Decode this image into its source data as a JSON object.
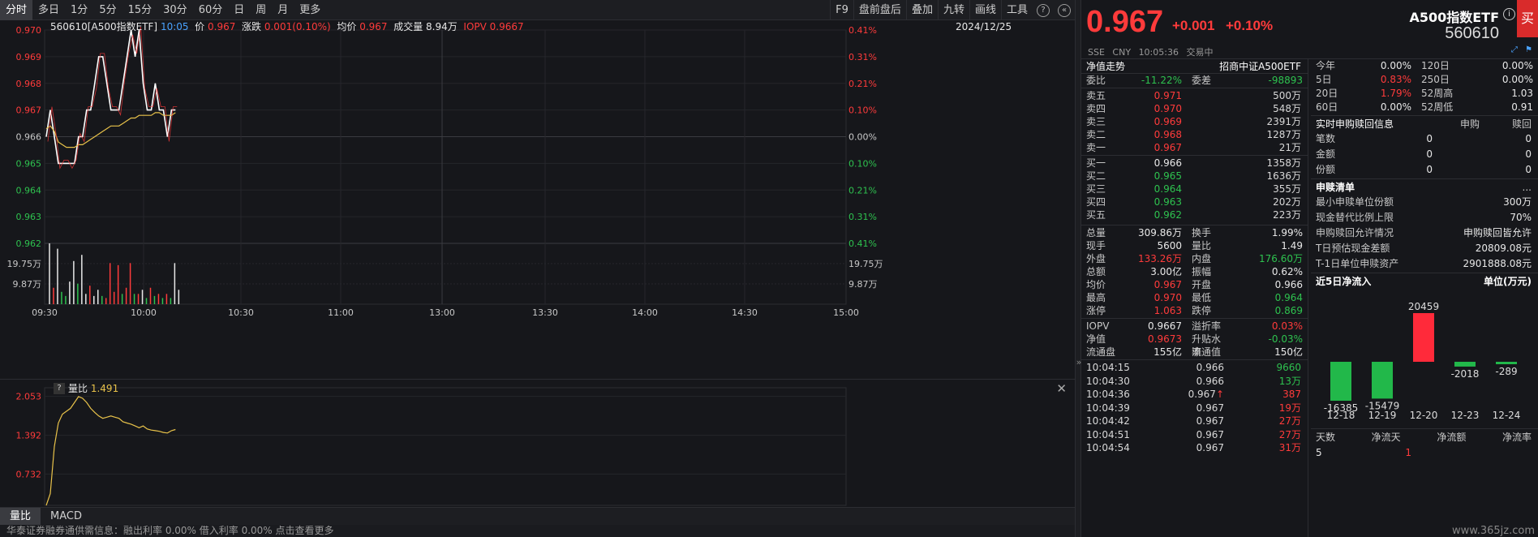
{
  "period_tabs": [
    "分时",
    "多日",
    "1分",
    "5分",
    "15分",
    "30分",
    "60分",
    "日",
    "周",
    "月",
    "更多"
  ],
  "toolbar_right": [
    "F9",
    "盘前盘后",
    "叠加",
    "九转",
    "画线",
    "工具"
  ],
  "toolbar_icons": {
    "help": "?",
    "collapse": "«"
  },
  "chart_header": {
    "symbol": "560610[A500指数ETF]",
    "time": "10:05",
    "price_label": "价",
    "price": "0.967",
    "change_label": "涨跌",
    "change": "0.001(0.10%)",
    "avg_label": "均价",
    "avg": "0.967",
    "vol_label": "成交量",
    "vol": "8.94万",
    "iopv_label": "IOPV",
    "iopv": "0.9667",
    "date": "2024/12/25"
  },
  "sub_header": {
    "q": "?",
    "label": "量比",
    "value": "1.491"
  },
  "bottom_tabs": [
    "量比",
    "MACD"
  ],
  "ticker_text": "华泰证券融券通供需信息：融出利率 0.00%  借入利率 0.00%  点击查看更多",
  "colors": {
    "up": "#ff3b3b",
    "down": "#2ec24f",
    "price_line": "#ffffff",
    "avg_line": "#e8c24a",
    "bg": "#16171b"
  },
  "chart_data": {
    "type": "line",
    "x_ticks": [
      "09:30",
      "10:00",
      "10:30",
      "11:00",
      "13:00",
      "13:30",
      "14:00",
      "14:30",
      "15:00"
    ],
    "y_ticks_price": [
      "0.970",
      "0.969",
      "0.968",
      "0.967",
      "0.966",
      "0.965",
      "0.964",
      "0.963",
      "0.962"
    ],
    "y_ticks_pct": [
      "0.41%",
      "0.31%",
      "0.21%",
      "0.10%",
      "0.00%",
      "0.10%",
      "0.21%",
      "0.31%",
      "0.41%"
    ],
    "ylim": [
      0.962,
      0.97
    ],
    "prev_close": 0.966,
    "volume_ticks": [
      "19.75万",
      "9.87万"
    ],
    "volume_max": 29.6,
    "ratio_ticks": [
      "2.053",
      "1.392",
      "0.732"
    ],
    "ratio_ylim": [
      0.2,
      2.2
    ],
    "series": [
      {
        "values": [
          0.966,
          0.967,
          0.966,
          0.965,
          0.965,
          0.965,
          0.965,
          0.965,
          0.966,
          0.966,
          0.967,
          0.967,
          0.968,
          0.969,
          0.969,
          0.968,
          0.967,
          0.967,
          0.967,
          0.968,
          0.969,
          0.97,
          0.969,
          0.97,
          0.968,
          0.967,
          0.967,
          0.968,
          0.967,
          0.967,
          0.966,
          0.967,
          0.967
        ]
      },
      {
        "values": [
          0.9663,
          0.9664,
          0.9662,
          0.9658,
          0.9657,
          0.9656,
          0.9656,
          0.9656,
          0.9657,
          0.9657,
          0.9658,
          0.9659,
          0.966,
          0.9661,
          0.9662,
          0.9663,
          0.9664,
          0.9664,
          0.9664,
          0.9665,
          0.9666,
          0.9667,
          0.9667,
          0.9668,
          0.9668,
          0.9668,
          0.9668,
          0.9669,
          0.9669,
          0.9668,
          0.9668,
          0.9668,
          0.9669
        ]
      }
    ],
    "volumes": [
      {
        "v": 29.6,
        "c": "white"
      },
      {
        "v": 8,
        "c": "red"
      },
      {
        "v": 27,
        "c": "white"
      },
      {
        "v": 6,
        "c": "green"
      },
      {
        "v": 4,
        "c": "green"
      },
      {
        "v": 11,
        "c": "white"
      },
      {
        "v": 21,
        "c": "white"
      },
      {
        "v": 10,
        "c": "green"
      },
      {
        "v": 24,
        "c": "white"
      },
      {
        "v": 5,
        "c": "white"
      },
      {
        "v": 9,
        "c": "red"
      },
      {
        "v": 4,
        "c": "white"
      },
      {
        "v": 7,
        "c": "white"
      },
      {
        "v": 4,
        "c": "green"
      },
      {
        "v": 3,
        "c": "red"
      },
      {
        "v": 20,
        "c": "red"
      },
      {
        "v": 6,
        "c": "red"
      },
      {
        "v": 19,
        "c": "red"
      },
      {
        "v": 5,
        "c": "green"
      },
      {
        "v": 8,
        "c": "red"
      },
      {
        "v": 20,
        "c": "red"
      },
      {
        "v": 5,
        "c": "green"
      },
      {
        "v": 5,
        "c": "red"
      },
      {
        "v": 7,
        "c": "white"
      },
      {
        "v": 3,
        "c": "green"
      },
      {
        "v": 8,
        "c": "red"
      },
      {
        "v": 4,
        "c": "green"
      },
      {
        "v": 5,
        "c": "red"
      },
      {
        "v": 3,
        "c": "green"
      },
      {
        "v": 5,
        "c": "red"
      },
      {
        "v": 3,
        "c": "green"
      },
      {
        "v": 20,
        "c": "white"
      },
      {
        "v": 7,
        "c": "white"
      }
    ],
    "ratio": [
      0.2,
      0.4,
      1.2,
      1.6,
      1.75,
      1.8,
      1.85,
      1.95,
      2.05,
      2.02,
      1.95,
      1.85,
      1.78,
      1.72,
      1.68,
      1.7,
      1.72,
      1.7,
      1.68,
      1.62,
      1.6,
      1.58,
      1.55,
      1.52,
      1.55,
      1.5,
      1.48,
      1.47,
      1.46,
      1.44,
      1.43,
      1.47,
      1.49
    ]
  },
  "quote": {
    "price": "0.967",
    "change": "+0.001",
    "change_pct": "+0.10%",
    "name": "A500指数ETF",
    "info_icon": "i",
    "code": "560610",
    "buy_label": "买",
    "exchange": "SSE",
    "currency": "CNY",
    "time": "10:05:36",
    "status": "交易中"
  },
  "orderbook": {
    "title": "净值走势",
    "index_name": "招商中证A500ETF",
    "weibi_label": "委比",
    "weibi": "-11.22%",
    "weicha_label": "委差",
    "weicha": "-98893",
    "asks": [
      {
        "label": "卖五",
        "price": "0.971",
        "vol": "500万"
      },
      {
        "label": "卖四",
        "price": "0.970",
        "vol": "548万"
      },
      {
        "label": "卖三",
        "price": "0.969",
        "vol": "2391万"
      },
      {
        "label": "卖二",
        "price": "0.968",
        "vol": "1287万"
      },
      {
        "label": "卖一",
        "price": "0.967",
        "vol": "21万"
      }
    ],
    "bids": [
      {
        "label": "买一",
        "price": "0.966",
        "vol": "1358万"
      },
      {
        "label": "买二",
        "price": "0.965",
        "vol": "1636万"
      },
      {
        "label": "买三",
        "price": "0.964",
        "vol": "355万"
      },
      {
        "label": "买四",
        "price": "0.963",
        "vol": "202万"
      },
      {
        "label": "买五",
        "price": "0.962",
        "vol": "223万"
      }
    ]
  },
  "stats": [
    [
      "总量",
      "309.86万",
      "换手",
      "1.99%"
    ],
    [
      "现手",
      "5600",
      "量比",
      "1.49"
    ],
    [
      "外盘",
      "133.26万",
      "内盘",
      "176.60万"
    ],
    [
      "总额",
      "3.00亿",
      "振幅",
      "0.62%"
    ],
    [
      "均价",
      "0.967",
      "开盘",
      "0.966"
    ],
    [
      "最高",
      "0.970",
      "最低",
      "0.964"
    ],
    [
      "涨停",
      "1.063",
      "跌停",
      "0.869"
    ]
  ],
  "iopv_stats": [
    [
      "IOPV",
      "0.9667",
      "溢折率",
      "0.03%"
    ],
    [
      "净值",
      "0.9673",
      "升贴水率",
      "-0.03%"
    ],
    [
      "流通盘",
      "155亿",
      "流通值",
      "150亿"
    ]
  ],
  "trades": [
    {
      "time": "10:04:15",
      "price": "0.966",
      "vol": "9660",
      "pc": "white",
      "vc": "green",
      "arrow": ""
    },
    {
      "time": "10:04:30",
      "price": "0.966",
      "vol": "13万",
      "pc": "white",
      "vc": "green",
      "arrow": ""
    },
    {
      "time": "10:04:36",
      "price": "0.967",
      "vol": "387",
      "pc": "red",
      "vc": "red",
      "arrow": "↑"
    },
    {
      "time": "10:04:39",
      "price": "0.967",
      "vol": "19万",
      "pc": "red",
      "vc": "red",
      "arrow": ""
    },
    {
      "time": "10:04:42",
      "price": "0.967",
      "vol": "27万",
      "pc": "red",
      "vc": "red",
      "arrow": ""
    },
    {
      "time": "10:04:51",
      "price": "0.967",
      "vol": "27万",
      "pc": "red",
      "vc": "red",
      "arrow": ""
    },
    {
      "time": "10:04:54",
      "price": "0.967",
      "vol": "31万",
      "pc": "red",
      "vc": "red",
      "arrow": ""
    }
  ],
  "period_returns": [
    [
      "今年",
      "0.00%",
      "120日",
      "0.00%"
    ],
    [
      "5日",
      "0.83%",
      "250日",
      "0.00%"
    ],
    [
      "20日",
      "1.79%",
      "52周高",
      "1.03"
    ],
    [
      "60日",
      "0.00%",
      "52周低",
      "0.91"
    ]
  ],
  "subscription": {
    "title": "实时申购赎回信息",
    "col1": "申购",
    "col2": "赎回",
    "rows": [
      [
        "笔数",
        "0",
        "0"
      ],
      [
        "金额",
        "0",
        "0"
      ],
      [
        "份额",
        "0",
        "0"
      ]
    ]
  },
  "creation_list": {
    "title": "申赎清单",
    "more": "...",
    "rows": [
      [
        "最小申赎单位份额",
        "300万"
      ],
      [
        "现金替代比例上限",
        "70%"
      ],
      [
        "申购赎回允许情况",
        "申购赎回皆允许"
      ],
      [
        "T日预估现金差额",
        "20809.08元"
      ],
      [
        "T-1日单位申赎资产",
        "2901888.08元"
      ]
    ]
  },
  "inflow": {
    "title": "近5日净流入",
    "unit": "单位(万元)",
    "footer": [
      "天数",
      "净流天",
      "净流额",
      "净流率"
    ],
    "footer_values": [
      "5",
      "1"
    ],
    "chart_data": {
      "type": "bar",
      "categories": [
        "12-18",
        "12-19",
        "12-20",
        "12-23",
        "12-24"
      ],
      "values": [
        -16385,
        -15479,
        20459,
        -2018,
        -289
      ]
    }
  },
  "watermark": "www.365jz.com"
}
